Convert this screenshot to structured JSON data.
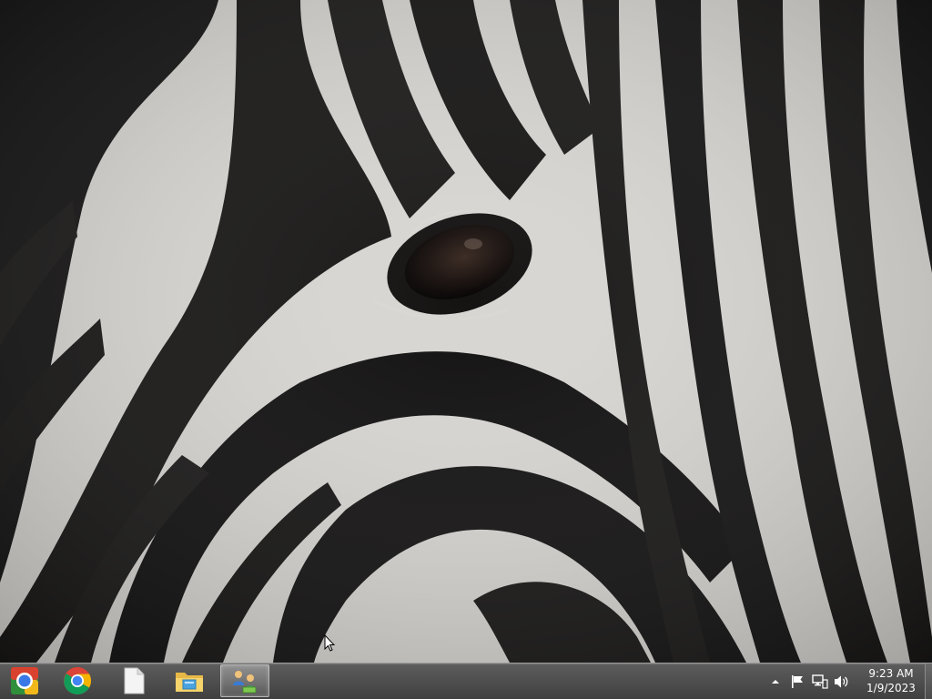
{
  "desktop": {
    "wallpaper_icon": "zebra-closeup-wallpaper"
  },
  "taskbar": {
    "items": [
      {
        "icon": "chrome-app-launcher-icon",
        "active": false
      },
      {
        "icon": "google-chrome-icon",
        "active": false
      },
      {
        "icon": "blank-document-icon",
        "active": false
      },
      {
        "icon": "file-explorer-icon",
        "active": false
      },
      {
        "icon": "network-window-icon",
        "active": true
      }
    ],
    "tray": {
      "icons": [
        "show-hidden-icons-icon",
        "action-center-flag-icon",
        "network-icon",
        "volume-icon"
      ]
    },
    "clock": {
      "time": "9:23 AM",
      "date": "1/9/2023"
    }
  },
  "colors": {
    "taskbar": "#4d4d4d",
    "chrome_red": "#db4437",
    "chrome_green": "#0f9d58",
    "chrome_yellow": "#f4b400",
    "chrome_blue": "#4285f4"
  }
}
